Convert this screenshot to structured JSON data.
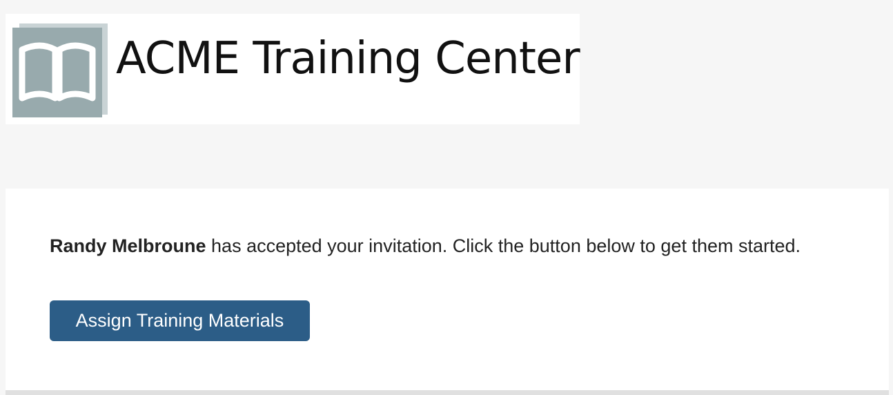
{
  "header": {
    "brand_name": "ACME Training Center",
    "logo_icon": "open-book-icon",
    "logo_colors": {
      "mark": "#98aaad",
      "mark_shadow": "#c9d3d5",
      "book": "#ffffff"
    }
  },
  "message": {
    "invitee_name": "Randy Melbroune",
    "text": " has accepted your invitation. Click the button below to get them started."
  },
  "actions": {
    "assign_label": "Assign Training Materials",
    "assign_color": "#2c5d87"
  }
}
